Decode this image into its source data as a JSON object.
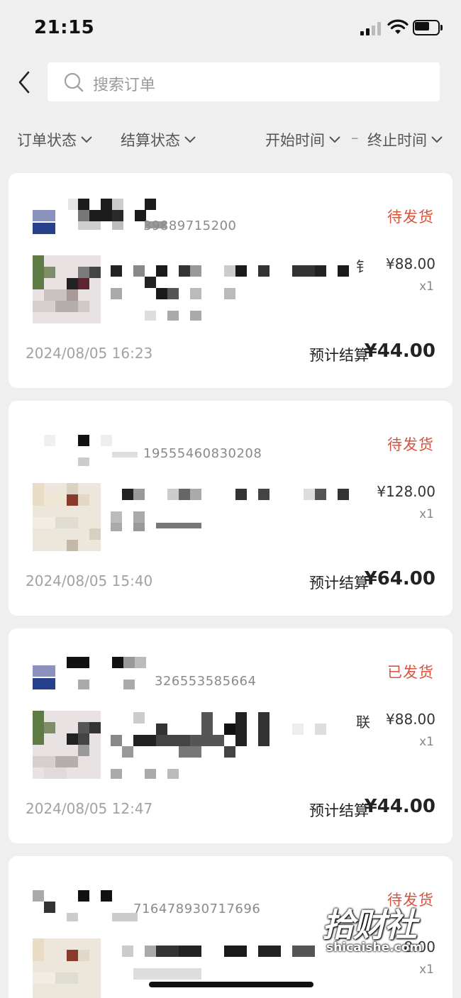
{
  "status_bar": {
    "time": "21:15"
  },
  "search": {
    "placeholder": "搜索订单"
  },
  "filters": {
    "order_status": "订单状态",
    "settle_status": "结算状态",
    "start_time": "开始时间",
    "separator": "–",
    "end_time": "终止时间"
  },
  "icons": {
    "back": "chevron-left-icon",
    "search": "search-icon",
    "dropdown": "chevron-down-icon"
  },
  "colors": {
    "status_accent": "#d9523b",
    "background": "#efefef",
    "card": "#ffffff"
  },
  "orders": [
    {
      "order_no_visible": "39889715200",
      "status": "待发货",
      "price": "¥88.00",
      "qty": "x1",
      "stray_char": "钅",
      "date": "2024/08/05 16:23",
      "settle_label": "预计结算",
      "settle_value": "¥44.00"
    },
    {
      "order_no_visible": "19555460830208",
      "status": "待发货",
      "price": "¥128.00",
      "qty": "x1",
      "stray_char": "",
      "date": "2024/08/05 15:40",
      "settle_label": "预计结算",
      "settle_value": "¥64.00"
    },
    {
      "order_no_visible": "326553585664",
      "status": "已发货",
      "price": "¥88.00",
      "qty": "x1",
      "stray_char": "联",
      "date": "2024/08/05 12:47",
      "settle_label": "预计结算",
      "settle_value": "¥44.00"
    },
    {
      "order_no_visible": "716478930717696",
      "status": "待发货",
      "price": "8.00",
      "qty": "x1",
      "stray_char": "",
      "date": "",
      "settle_label": "",
      "settle_value": ""
    }
  ],
  "watermark": {
    "brand": "拾财社",
    "domain": "shicaishe.com"
  }
}
